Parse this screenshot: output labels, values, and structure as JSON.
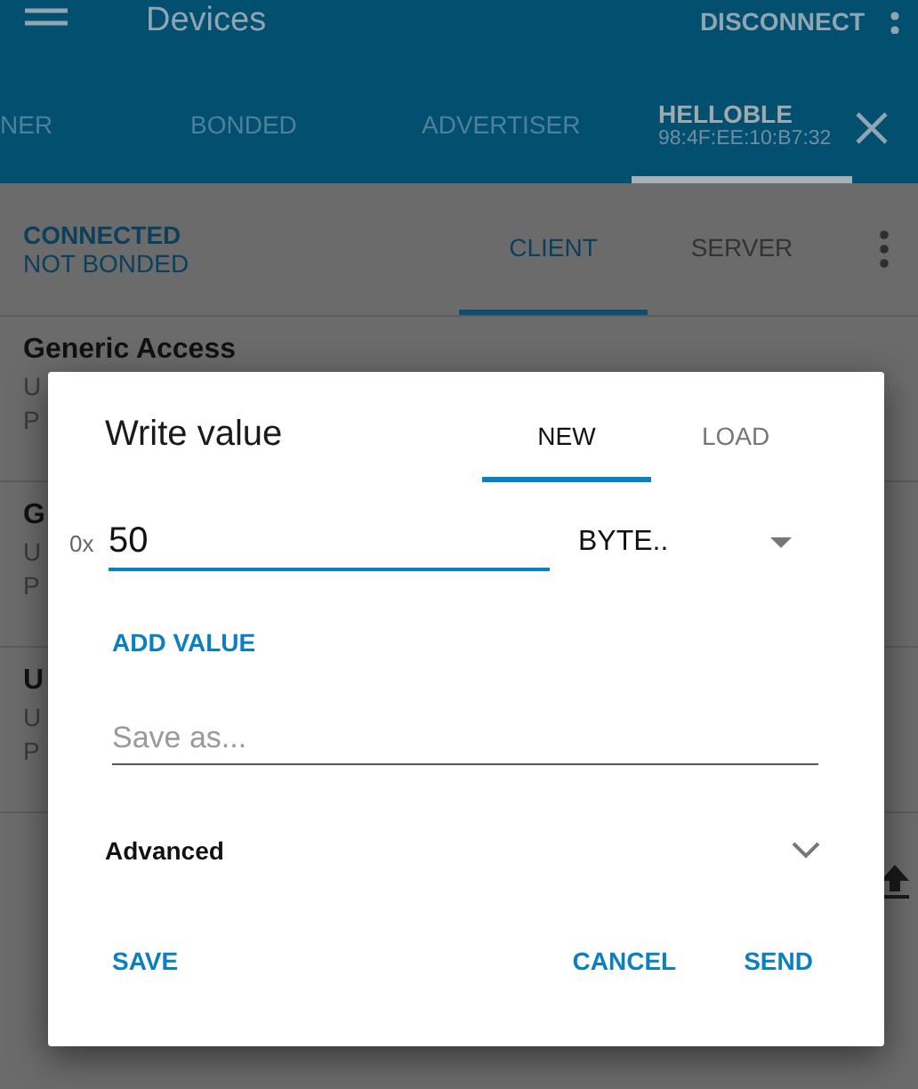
{
  "app_bar": {
    "title": "Devices",
    "action": "DISCONNECT"
  },
  "tabs": [
    {
      "label": "NER",
      "selected": false
    },
    {
      "label": "BONDED",
      "selected": false
    },
    {
      "label": "ADVERTISER",
      "selected": false
    },
    {
      "label": "HELLOBLE",
      "subtitle": "98:4F:EE:10:B7:32",
      "selected": true
    }
  ],
  "connection": {
    "state": "CONNECTED",
    "bond": "NOT BONDED"
  },
  "mode_tabs": [
    {
      "label": "CLIENT",
      "selected": true
    },
    {
      "label": "SERVER",
      "selected": false
    }
  ],
  "services": [
    {
      "name": "Generic Access",
      "line_1": "U",
      "line_2": "P"
    },
    {
      "name": "G",
      "line_1": "U",
      "line_2": "P"
    },
    {
      "name": "U",
      "line_1": "U",
      "line_2": "P"
    }
  ],
  "dialog": {
    "title": "Write value",
    "tabs": [
      {
        "label": "NEW",
        "selected": true
      },
      {
        "label": "LOAD",
        "selected": false
      }
    ],
    "prefix": "0x",
    "value": "50",
    "format": "BYTE..",
    "add_value": "ADD VALUE",
    "save_as": {
      "placeholder": "Save as..."
    },
    "advanced": {
      "label": "Advanced",
      "expanded": false
    },
    "buttons": [
      "SAVE",
      "CANCEL",
      "SEND"
    ]
  }
}
